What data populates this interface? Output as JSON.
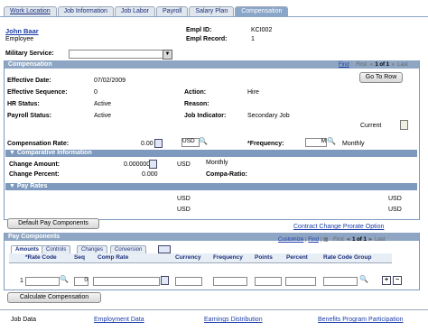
{
  "tabs": [
    "Work Location",
    "Job Information",
    "Job Labor",
    "Payroll",
    "Salary Plan",
    "Compensation"
  ],
  "header": {
    "name": "John Baar",
    "role": "Employee",
    "empl_id_label": "Empl ID:",
    "empl_id": "KCI002",
    "empl_record_label": "Empl Record:",
    "empl_record": "1",
    "military_label": "Military Service:"
  },
  "compensation": {
    "title": "Compensation",
    "find": "Find",
    "first": "First",
    "pager": "1 of 1",
    "last": "Last",
    "go_to_row": "Go To Row",
    "effective_date_label": "Effective Date:",
    "effective_date": "07/02/2009",
    "action_label": "Action:",
    "action": "Hire",
    "effective_seq_label": "Effective Sequence:",
    "effective_seq": "0",
    "reason_label": "Reason:",
    "hr_status_label": "HR Status:",
    "hr_status": "Active",
    "payroll_status_label": "Payroll Status:",
    "payroll_status": "Active",
    "job_indicator_label": "Job Indicator:",
    "job_indicator": "Secondary Job",
    "current": "Current",
    "comp_rate_label": "Compensation Rate:",
    "comp_rate": "0.00",
    "currency": "USD",
    "frequency_label": "*Frequency:",
    "frequency": "M",
    "frequency_text": "Monthly"
  },
  "comparative": {
    "title": "Comparative Information",
    "change_amount_label": "Change Amount:",
    "change_amount": "0.000000",
    "currency": "USD",
    "frequency": "Monthly",
    "change_percent_label": "Change Percent:",
    "change_percent": "0.000",
    "compa_ratio_label": "Compa-Ratio:"
  },
  "pay_rates": {
    "title": "Pay Rates",
    "rows": [
      [
        "USD",
        "USD"
      ],
      [
        "USD",
        "USD"
      ]
    ]
  },
  "default_pay_button": "Default Pay Components",
  "contract_link": "Contract Change Prorate Option",
  "pay_components": {
    "title": "Pay Components",
    "customize": "Customize",
    "find": "Find",
    "first": "First",
    "pager": "1 of 1",
    "last": "Last",
    "subtabs": [
      "Amounts",
      "Controls",
      "Changes",
      "Conversion"
    ],
    "columns": [
      "*Rate Code",
      "Seq",
      "Comp Rate",
      "Currency",
      "Frequency",
      "Points",
      "Percent",
      "Rate Code Group"
    ],
    "row_number": "1",
    "seq_value": "0"
  },
  "calc_button": "Calculate Compensation",
  "footer": {
    "label": "Job Data",
    "links": [
      "Employment Data",
      "Earnings Distribution",
      "Benefits Program Participation"
    ]
  }
}
